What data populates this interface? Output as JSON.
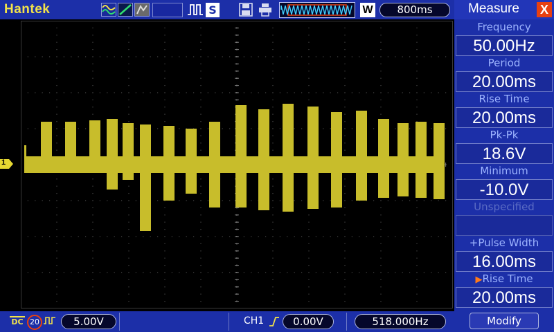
{
  "header": {
    "brand": "Hantek",
    "icons": [
      "signal-wave-icon",
      "slope-icon",
      "display-mode-icon",
      "pulse-icon",
      "s-icon",
      "save-icon",
      "print-icon"
    ],
    "s_label": "S",
    "w_label": "W",
    "timebase": "800ms"
  },
  "footer": {
    "coupling": "DC",
    "bandwidth_limit": "20",
    "ch1_scale": "5.00V",
    "trigger_source": "CH1",
    "trigger_level": "0.00V",
    "frequency": "518.000Hz"
  },
  "screen": {
    "channel_marker": "1",
    "trace_color": "#c8bd2b"
  },
  "measure": {
    "title": "Measure",
    "close_label": "X",
    "items": [
      {
        "label": "Frequency",
        "value": "50.00Hz"
      },
      {
        "label": "Period",
        "value": "20.00ms"
      },
      {
        "label": "Rise Time",
        "value": "20.00ms"
      },
      {
        "label": "Pk-Pk",
        "value": "18.6V"
      },
      {
        "label": "Minimum",
        "value": "-10.0V"
      },
      {
        "label": "Unspecified",
        "value": ""
      },
      {
        "label": "+Pulse Width",
        "value": "16.00ms"
      },
      {
        "label": "Rise Time",
        "value": "20.00ms"
      }
    ],
    "modify_label": "Modify"
  },
  "colors": {
    "bar": "#1c2fa8",
    "accent": "#f2e24a",
    "trace": "#c8bd2b",
    "close": "#e84010"
  }
}
